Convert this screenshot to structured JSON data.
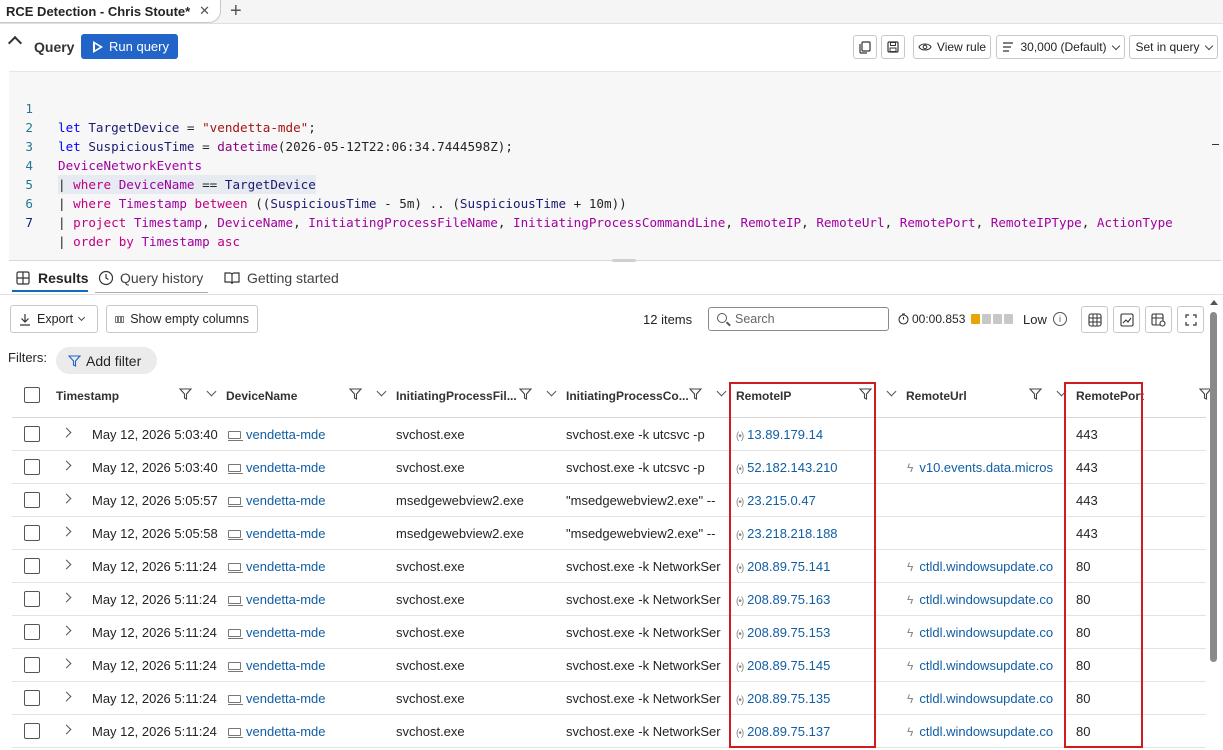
{
  "tab": {
    "title": "RCE Detection - Chris Stoute*",
    "close": "✕",
    "add": "+"
  },
  "query_bar": {
    "label": "Query",
    "run_label": "Run query",
    "view_rule": "View rule",
    "limit": "30,000 (Default)",
    "time_setting": "Set in query"
  },
  "editor": {
    "line_numbers": [
      "1",
      "2",
      "3",
      "4",
      "5",
      "6",
      "7"
    ]
  },
  "results_tabs": {
    "results": "Results",
    "history": "Query history",
    "started": "Getting started"
  },
  "results_toolbar": {
    "export": "Export",
    "show_empty": "Show empty columns",
    "items": "12 items",
    "search_placeholder": "Search",
    "elapsed": "00:00.853",
    "resource_level": "Low",
    "resource_bars_filled": 1,
    "resource_bars_total": 4
  },
  "filters": {
    "label": "Filters:",
    "add": "Add filter"
  },
  "columns": [
    "Timestamp",
    "DeviceName",
    "InitiatingProcessFil...",
    "InitiatingProcessCo...",
    "RemoteIP",
    "RemoteUrl",
    "RemotePort"
  ],
  "rows": [
    {
      "ts": "May 12, 2026 5:03:40",
      "dev": "vendetta-mde",
      "file": "svchost.exe",
      "cmd": "svchost.exe -k utcsvc -p",
      "ip": "13.89.179.14",
      "url": "",
      "port": "443"
    },
    {
      "ts": "May 12, 2026 5:03:40",
      "dev": "vendetta-mde",
      "file": "svchost.exe",
      "cmd": "svchost.exe -k utcsvc -p",
      "ip": "52.182.143.210",
      "url": "v10.events.data.micros",
      "port": "443"
    },
    {
      "ts": "May 12, 2026 5:05:57",
      "dev": "vendetta-mde",
      "file": "msedgewebview2.exe",
      "cmd": "\"msedgewebview2.exe\" --",
      "ip": "23.215.0.47",
      "url": "",
      "port": "443"
    },
    {
      "ts": "May 12, 2026 5:05:58",
      "dev": "vendetta-mde",
      "file": "msedgewebview2.exe",
      "cmd": "\"msedgewebview2.exe\" --",
      "ip": "23.218.218.188",
      "url": "",
      "port": "443"
    },
    {
      "ts": "May 12, 2026 5:11:24",
      "dev": "vendetta-mde",
      "file": "svchost.exe",
      "cmd": "svchost.exe -k NetworkSer",
      "ip": "208.89.75.141",
      "url": "ctldl.windowsupdate.co",
      "port": "80"
    },
    {
      "ts": "May 12, 2026 5:11:24",
      "dev": "vendetta-mde",
      "file": "svchost.exe",
      "cmd": "svchost.exe -k NetworkSer",
      "ip": "208.89.75.163",
      "url": "ctldl.windowsupdate.co",
      "port": "80"
    },
    {
      "ts": "May 12, 2026 5:11:24",
      "dev": "vendetta-mde",
      "file": "svchost.exe",
      "cmd": "svchost.exe -k NetworkSer",
      "ip": "208.89.75.153",
      "url": "ctldl.windowsupdate.co",
      "port": "80"
    },
    {
      "ts": "May 12, 2026 5:11:24",
      "dev": "vendetta-mde",
      "file": "svchost.exe",
      "cmd": "svchost.exe -k NetworkSer",
      "ip": "208.89.75.145",
      "url": "ctldl.windowsupdate.co",
      "port": "80"
    },
    {
      "ts": "May 12, 2026 5:11:24",
      "dev": "vendetta-mde",
      "file": "svchost.exe",
      "cmd": "svchost.exe -k NetworkSer",
      "ip": "208.89.75.135",
      "url": "ctldl.windowsupdate.co",
      "port": "80"
    },
    {
      "ts": "May 12, 2026 5:11:24",
      "dev": "vendetta-mde",
      "file": "svchost.exe",
      "cmd": "svchost.exe -k NetworkSer",
      "ip": "208.89.75.137",
      "url": "ctldl.windowsupdate.co",
      "port": "80"
    }
  ],
  "colors": {
    "accent": "#2264c8",
    "link": "#115ea3",
    "highlight": "#d01c1c",
    "resource_on": "#e8a400"
  }
}
